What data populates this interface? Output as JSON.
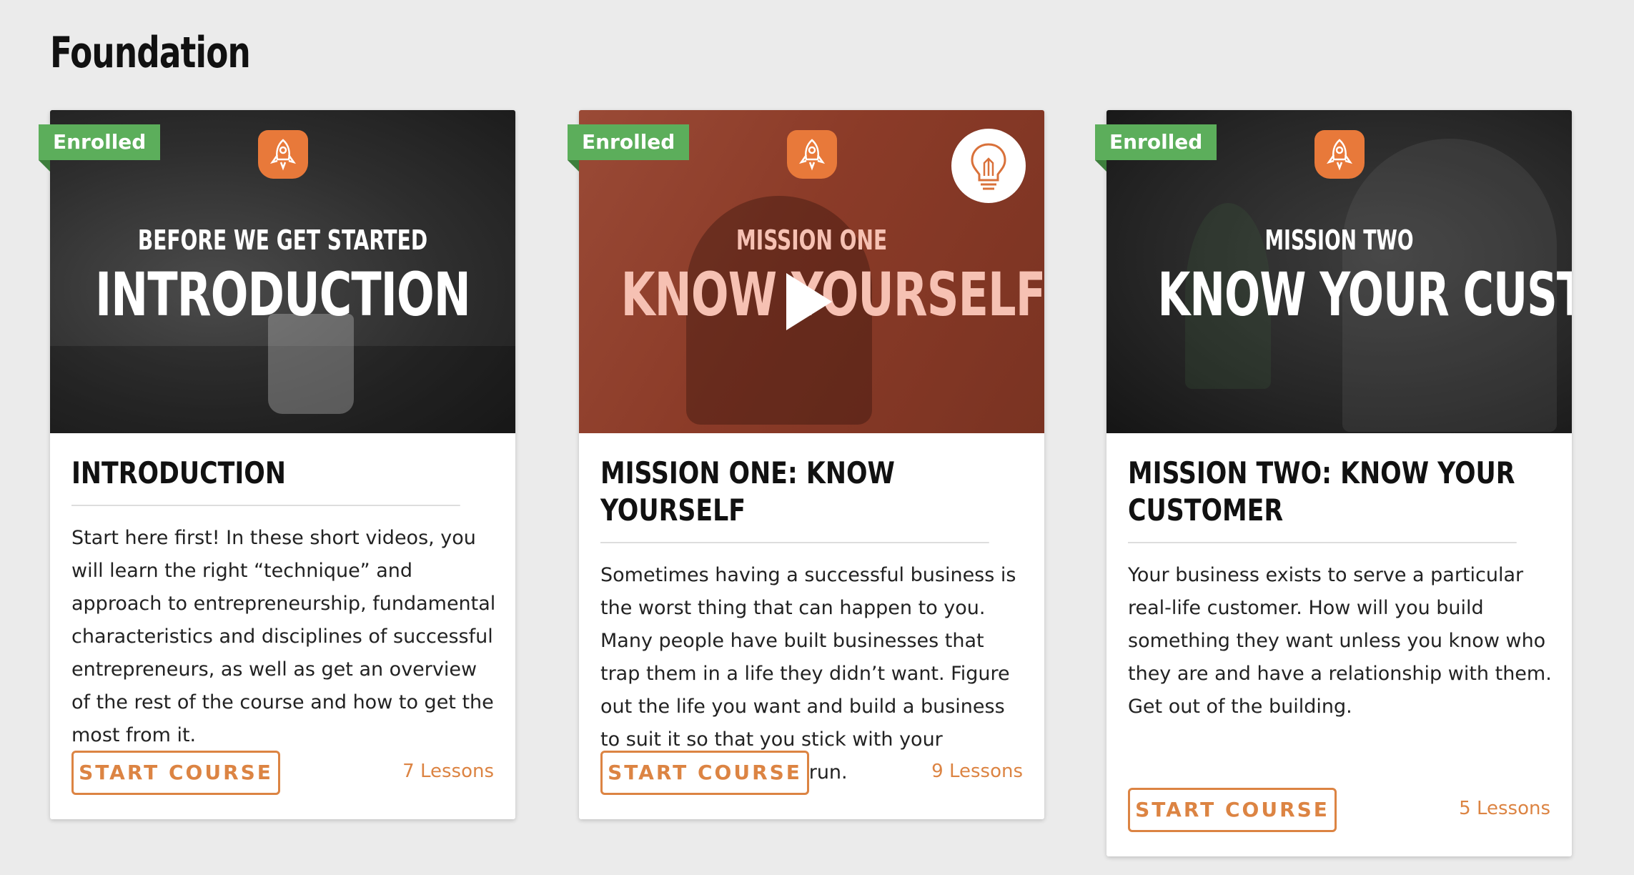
{
  "section": {
    "title": "Foundation"
  },
  "courses": [
    {
      "badge": "Enrolled",
      "thumb_kicker": "BEFORE WE GET STARTED",
      "thumb_headline": "INTRODUCTION",
      "title": "INTRODUCTION",
      "description": "Start here first! In these short videos, you will learn the right “technique” and approach to entrepreneurship, fundamental characteristics and disciplines of successful entrepreneurs, as well as get an overview of the rest of the course and how to get the most from it.",
      "button": "START COURSE",
      "lessons": "7 Lessons"
    },
    {
      "badge": "Enrolled",
      "thumb_kicker": "MISSION ONE",
      "thumb_headline": "KNOW YOURSELF",
      "title": "MISSION ONE: KNOW YOURSELF",
      "description": "Sometimes having a successful business is the worst thing that can happen to you. Many people have built businesses that trap them in a life they didn’t want. Figure out the life you want and build a business to suit it so that you stick with your business for the long run.",
      "button": "START COURSE",
      "lessons": "9 Lessons"
    },
    {
      "badge": "Enrolled",
      "thumb_kicker": "MISSION TWO",
      "thumb_headline": "KNOW YOUR CUSTOMER",
      "title": "MISSION TWO: KNOW YOUR CUSTOMER",
      "description": "Your business exists to serve a particular real-life customer. How will you build something they want unless you know who they are and have a relationship with them. Get out of the building.",
      "button": "START COURSE",
      "lessons": "5 Lessons"
    }
  ],
  "icons": {
    "badge": "rocket-icon",
    "play": "play-icon",
    "feature": "lightbulb-icon"
  },
  "colors": {
    "accent": "#dc8443",
    "enrolled": "#5cae5b",
    "rocket_badge": "#e8793a",
    "background": "#ebebeb"
  }
}
